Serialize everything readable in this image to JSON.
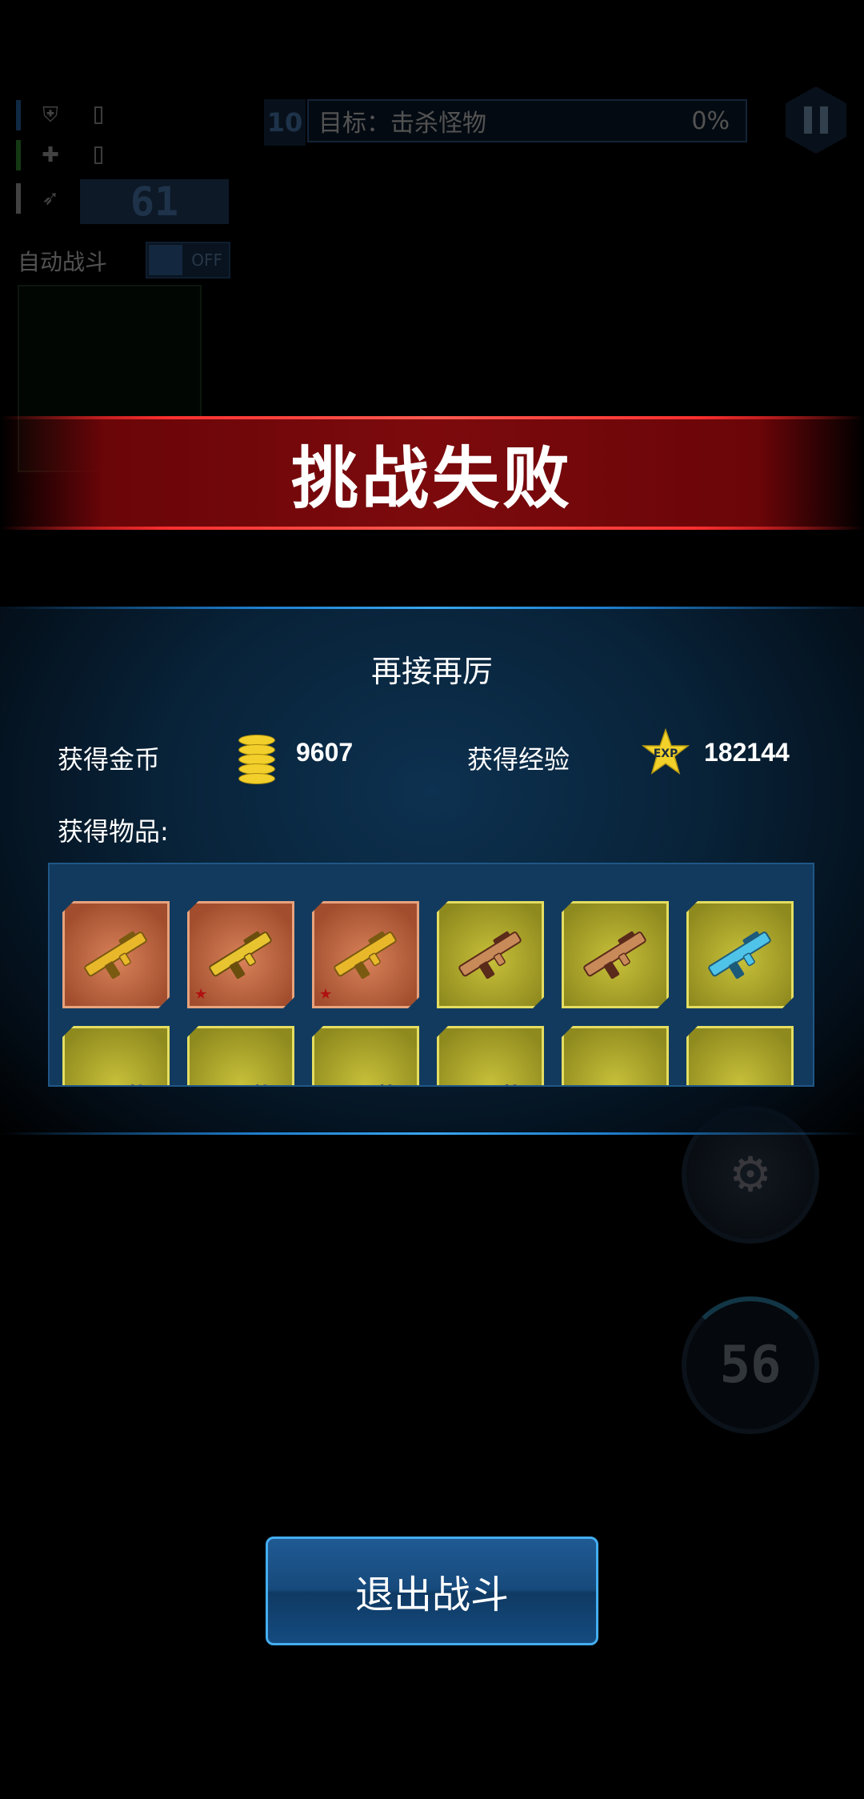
{
  "hud": {
    "ammo": "61",
    "auto_battle_label": "自动战斗",
    "auto_battle_state": "OFF",
    "wave": "10",
    "objective": "目标：击杀怪物",
    "objective_progress": "0%",
    "cooldown": "56"
  },
  "result": {
    "title": "挑战失败",
    "subtitle": "再接再厉",
    "gold_label": "获得金币",
    "gold_value": "9607",
    "exp_label": "获得经验",
    "exp_value": "182144",
    "exp_badge": "EXP",
    "items_label": "获得物品:"
  },
  "items": [
    {
      "rarity": "orange",
      "icon": "golden-rifle-icon",
      "star": false
    },
    {
      "rarity": "orange",
      "icon": "golden-pistol-icon",
      "star": true
    },
    {
      "rarity": "orange",
      "icon": "golden-rifle-icon",
      "star": true
    },
    {
      "rarity": "yellow",
      "icon": "striped-shotgun-icon",
      "star": false
    },
    {
      "rarity": "yellow",
      "icon": "striped-shotgun-icon",
      "star": false
    },
    {
      "rarity": "yellow",
      "icon": "blue-energy-rifle-icon",
      "star": false
    },
    {
      "rarity": "yellow",
      "icon": "silver-rifle-icon",
      "star": false
    },
    {
      "rarity": "yellow",
      "icon": "silver-rifle-icon",
      "star": false
    },
    {
      "rarity": "yellow",
      "icon": "gray-shotgun-icon",
      "star": false
    },
    {
      "rarity": "yellow",
      "icon": "gray-shotgun-icon",
      "star": false
    },
    {
      "rarity": "yellow",
      "icon": "orange-helmet-icon",
      "star": false
    },
    {
      "rarity": "yellow",
      "icon": "blue-helmet-icon",
      "star": false
    }
  ],
  "exit_button": "退出战斗",
  "colors": {
    "banner_red": "#7c0a0d",
    "panel_blue": "#082238",
    "item_orange": "#a24e2e",
    "item_yellow": "#8f8a1e",
    "button_border": "#44aef0",
    "coin_gold": "#f2cf2a"
  }
}
